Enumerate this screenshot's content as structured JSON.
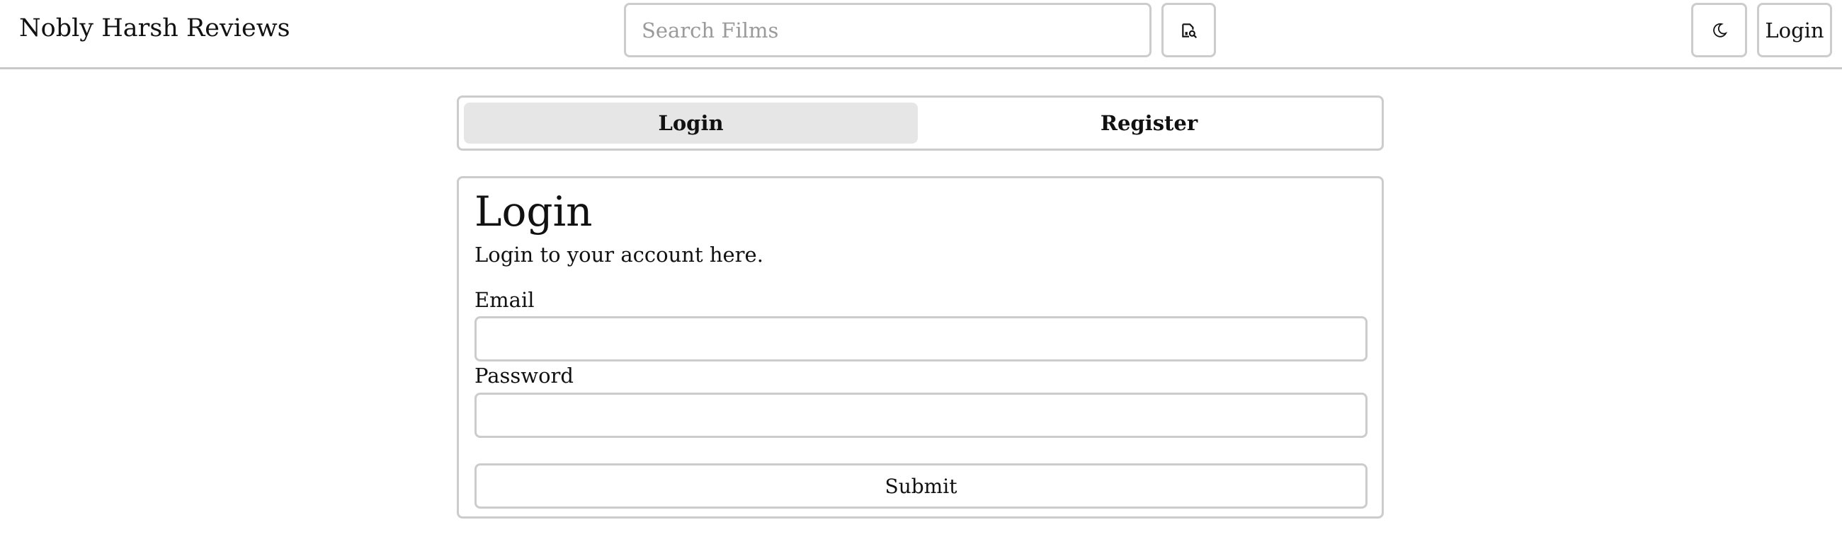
{
  "header": {
    "brand": "Nobly Harsh Reviews",
    "search": {
      "placeholder": "Search Films",
      "value": ""
    },
    "search_button_icon": "search-film-icon",
    "theme_toggle_icon": "moon-icon",
    "login_label": "Login"
  },
  "tabs": [
    {
      "label": "Login",
      "active": true
    },
    {
      "label": "Register",
      "active": false
    }
  ],
  "form": {
    "title": "Login",
    "description": "Login to your account here.",
    "email_label": "Email",
    "email_value": "",
    "password_label": "Password",
    "password_value": "",
    "submit_label": "Submit"
  },
  "colors": {
    "border": "#cccccc",
    "active_tab_bg": "#e6e6e6",
    "placeholder": "#9a9a9a",
    "text": "#111111"
  }
}
